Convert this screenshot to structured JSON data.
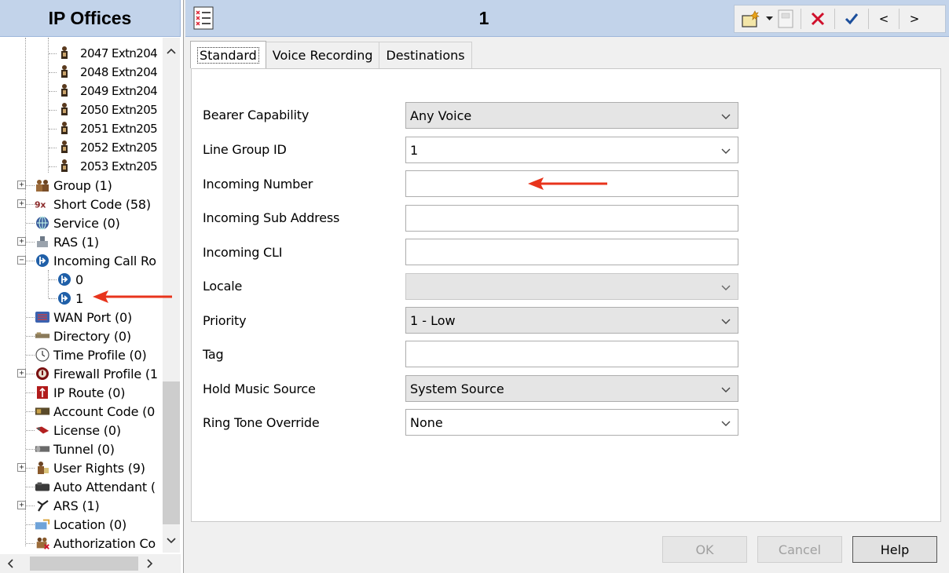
{
  "nav": {
    "title": "IP Offices",
    "tree": [
      {
        "label": "2047 Extn204",
        "icon": "user-phone-icon",
        "indent": 2
      },
      {
        "label": "2048 Extn204",
        "icon": "user-phone-icon",
        "indent": 2
      },
      {
        "label": "2049 Extn204",
        "icon": "user-phone-icon",
        "indent": 2
      },
      {
        "label": "2050 Extn205",
        "icon": "user-phone-icon",
        "indent": 2
      },
      {
        "label": "2051 Extn205",
        "icon": "user-phone-icon",
        "indent": 2
      },
      {
        "label": "2052 Extn205",
        "icon": "user-phone-icon",
        "indent": 2
      },
      {
        "label": "2053 Extn205",
        "icon": "user-phone-icon",
        "indent": 2
      },
      {
        "label": "Group (1)",
        "icon": "group-icon",
        "indent": 1,
        "expander": "+"
      },
      {
        "label": "Short Code (58)",
        "icon": "short-code-icon",
        "indent": 1,
        "expander": "+"
      },
      {
        "label": "Service (0)",
        "icon": "service-icon",
        "indent": 1
      },
      {
        "label": "RAS (1)",
        "icon": "ras-icon",
        "indent": 1,
        "expander": "+"
      },
      {
        "label": "Incoming Call Ro",
        "icon": "incoming-call-route-icon",
        "indent": 1,
        "expander": "−",
        "selected": true
      },
      {
        "label": "0",
        "icon": "incoming-call-route-icon",
        "indent": 2
      },
      {
        "label": "1",
        "icon": "incoming-call-route-icon",
        "indent": 2
      },
      {
        "label": "WAN Port (0)",
        "icon": "wan-port-icon",
        "indent": 1
      },
      {
        "label": "Directory (0)",
        "icon": "directory-icon",
        "indent": 1
      },
      {
        "label": "Time Profile (0)",
        "icon": "time-profile-icon",
        "indent": 1
      },
      {
        "label": "Firewall Profile (1",
        "icon": "firewall-icon",
        "indent": 1,
        "expander": "+"
      },
      {
        "label": "IP Route (0)",
        "icon": "ip-route-icon",
        "indent": 1
      },
      {
        "label": "Account Code (0",
        "icon": "account-code-icon",
        "indent": 1
      },
      {
        "label": "License (0)",
        "icon": "license-icon",
        "indent": 1
      },
      {
        "label": "Tunnel (0)",
        "icon": "tunnel-icon",
        "indent": 1
      },
      {
        "label": "User Rights (9)",
        "icon": "user-rights-icon",
        "indent": 1,
        "expander": "+"
      },
      {
        "label": "Auto Attendant (",
        "icon": "auto-attendant-icon",
        "indent": 1
      },
      {
        "label": "ARS (1)",
        "icon": "ars-icon",
        "indent": 1,
        "expander": "+"
      },
      {
        "label": "Location (0)",
        "icon": "location-icon",
        "indent": 1
      },
      {
        "label": "Authorization Co",
        "icon": "authorization-code-icon",
        "indent": 1
      }
    ]
  },
  "record": {
    "title": "1"
  },
  "toolbar": {
    "new_icon": "new-record-icon",
    "dropdown_icon": "dropdown-arrow-icon",
    "export_icon": "export-icon",
    "delete_icon": "delete-icon",
    "validate_icon": "checkmark-icon",
    "prev_label": "<",
    "next_label": ">"
  },
  "tabs": [
    {
      "label": "Standard",
      "active": true
    },
    {
      "label": "Voice Recording",
      "active": false
    },
    {
      "label": "Destinations",
      "active": false
    }
  ],
  "form": {
    "bearer_capability": {
      "label": "Bearer Capability",
      "value": "Any Voice"
    },
    "line_group_id": {
      "label": "Line Group ID",
      "value": "1"
    },
    "incoming_number": {
      "label": "Incoming Number",
      "value": ""
    },
    "incoming_sub_address": {
      "label": "Incoming Sub Address",
      "value": ""
    },
    "incoming_cli": {
      "label": "Incoming CLI",
      "value": ""
    },
    "locale": {
      "label": "Locale",
      "value": ""
    },
    "priority": {
      "label": "Priority",
      "value": "1 - Low"
    },
    "tag": {
      "label": "Tag",
      "value": ""
    },
    "hold_music_source": {
      "label": "Hold Music Source",
      "value": "System Source"
    },
    "ring_tone_override": {
      "label": "Ring Tone Override",
      "value": "None"
    }
  },
  "buttons": {
    "ok": "OK",
    "cancel": "Cancel",
    "help": "Help"
  },
  "colors": {
    "header_bg": "#c2d3ea",
    "annotation_arrow": "#e8341c",
    "icon_blue": "#1f5fa8"
  }
}
